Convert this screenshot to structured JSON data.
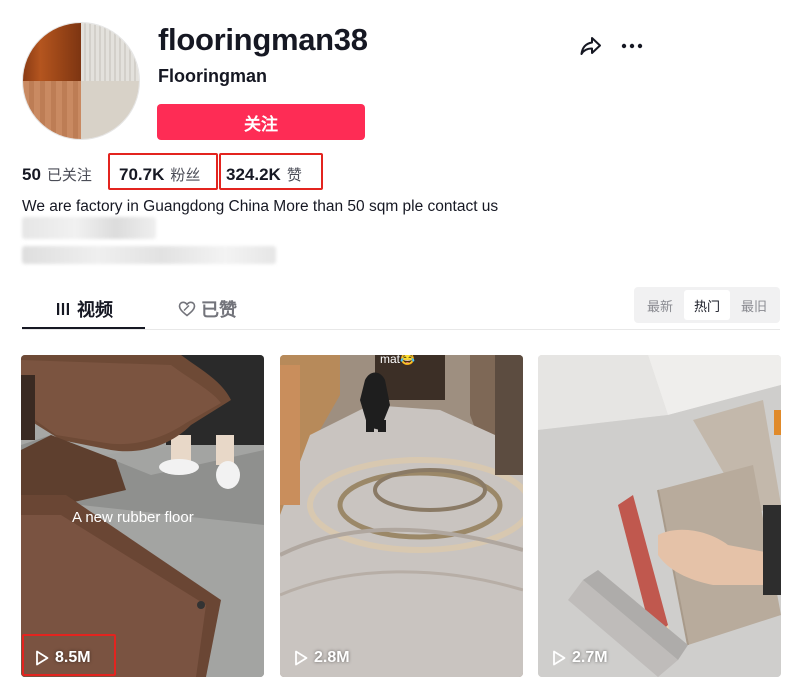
{
  "profile": {
    "username": "flooringman38",
    "nickname": "Flooringman",
    "follow_label": "关注",
    "stats": {
      "following": {
        "count": "50",
        "label": "已关注"
      },
      "followers": {
        "count": "70.7K",
        "label": "粉丝"
      },
      "likes": {
        "count": "324.2K",
        "label": "赞"
      }
    },
    "bio": "We are factory in Guangdong China More than 50 sqm ple contact us"
  },
  "actions": {
    "share_icon": "share-icon",
    "more_icon": "more-icon"
  },
  "tabs": [
    {
      "label": "视频",
      "icon": "grid-icon",
      "active": true
    },
    {
      "label": "已赞",
      "icon": "heart-icon",
      "active": false
    }
  ],
  "sort": {
    "options": [
      "最新",
      "热门",
      "最旧"
    ],
    "selected": "热门"
  },
  "videos": [
    {
      "views": "8.5M",
      "caption": "A new rubber floor"
    },
    {
      "views": "2.8M",
      "caption": "mat😂"
    },
    {
      "views": "2.7M",
      "caption": ""
    }
  ],
  "colors": {
    "accent": "#fe2c55",
    "highlight_box": "#e3241f",
    "text": "#161823"
  }
}
